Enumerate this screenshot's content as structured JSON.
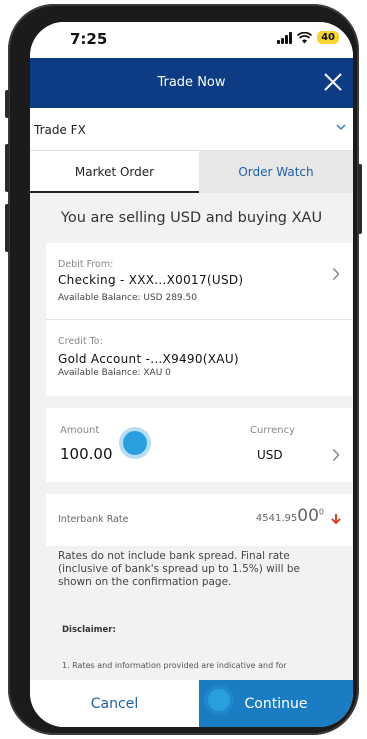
{
  "status_bar": {
    "time": "7:25",
    "battery": "40"
  },
  "header": {
    "title": "Trade Now"
  },
  "trade_type": {
    "label": "Trade FX"
  },
  "tabs": [
    {
      "label": "Market Order",
      "active": true
    },
    {
      "label": "Order Watch",
      "active": false
    }
  ],
  "summary": "You are selling USD and buying XAU",
  "debit": {
    "label": "Debit From:",
    "account": "Checking - XXX...X0017(USD)",
    "balance": "Available Balance: USD 289.50"
  },
  "credit": {
    "label": "Credit To:",
    "account": "Gold Account -...X9490(XAU)",
    "balance": "Available Balance: XAU 0"
  },
  "amount": {
    "label": "Amount",
    "value": "100.00"
  },
  "currency": {
    "label": "Currency",
    "value": "USD"
  },
  "rate": {
    "label": "Interbank Rate",
    "value_main": "4541.95",
    "value_big": "00",
    "value_sup": "0",
    "trend": "down"
  },
  "note": "Rates do not include bank spread. Final rate (inclusive of bank's spread up to 1.5%) will be shown on the confirmation page.",
  "disclaimer": {
    "title": "Disclaimer:",
    "item1": "1. Rates and information provided are indicative and for"
  },
  "footer": {
    "cancel": "Cancel",
    "continue": "Continue"
  },
  "colors": {
    "header": "#0d3b84",
    "accent": "#1a7dc4",
    "link": "#1f5fa8",
    "rate_down": "#d9442b"
  }
}
